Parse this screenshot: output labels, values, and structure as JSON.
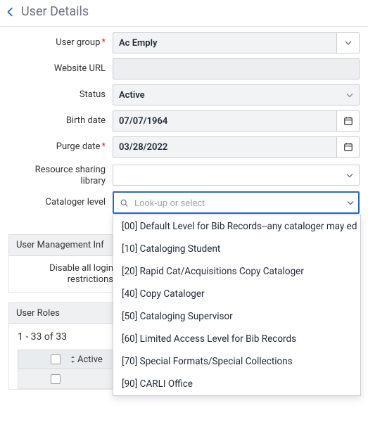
{
  "header": {
    "title": "User Details"
  },
  "form": {
    "user_group": {
      "label": "User group",
      "required": true,
      "value": "Ac  Emply"
    },
    "website_url": {
      "label": "Website URL",
      "required": false,
      "value": ""
    },
    "status": {
      "label": "Status",
      "required": false,
      "value": "Active"
    },
    "birth_date": {
      "label": "Birth date",
      "required": false,
      "value": "07/07/1964"
    },
    "purge_date": {
      "label": "Purge date",
      "required": true,
      "value": "03/28/2022"
    },
    "resource_sharing": {
      "label": "Resource sharing library",
      "required": false,
      "value": ""
    },
    "cataloger_level": {
      "label": "Cataloger level",
      "required": false,
      "placeholder": "Look-up or select",
      "options": [
        "[00] Default Level for Bib Records--any cataloger may ed",
        "[10] Cataloging Student",
        "[20] Rapid Cat/Acquisitions Copy Cataloger",
        "[40] Copy Cataloger",
        "[50] Cataloging Supervisor",
        "[60] Limited Access Level for Bib Records",
        "[70] Special Formats/Special Collections",
        "[90] CARLI Office"
      ]
    }
  },
  "sections": {
    "user_mgmt": {
      "title": "User Management Inf",
      "disable_all_label": "Disable all login restrictions"
    },
    "user_roles": {
      "title": "User Roles",
      "range": "1 - 33 of 33",
      "col_active": "Active"
    }
  }
}
